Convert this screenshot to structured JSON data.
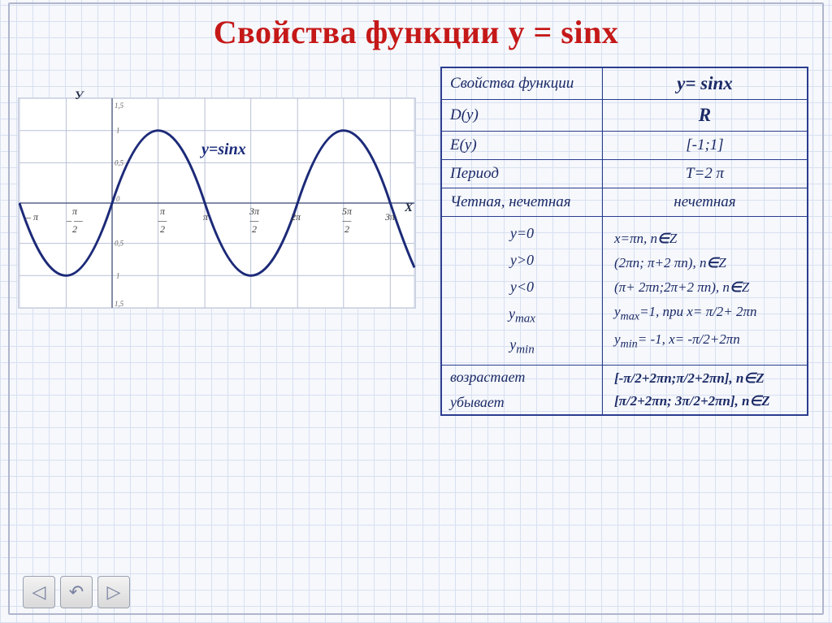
{
  "title": "Свойства функции y = sinx",
  "chart_label": "y=sinx",
  "axis_y": "У",
  "axis_x": "Х",
  "chart_data": {
    "type": "line",
    "title": "y = sin x",
    "xlabel": "x",
    "ylabel": "y",
    "xlim": [
      -3.5,
      10
    ],
    "ylim": [
      -1.5,
      1.5
    ],
    "x_ticks": [
      "-π",
      "-π/2",
      "0",
      "π/2",
      "π",
      "3π/2",
      "2π",
      "5π/2",
      "3π"
    ],
    "x_tick_values": [
      -3.1416,
      -1.5708,
      0,
      1.5708,
      3.1416,
      4.7124,
      6.2832,
      7.854,
      9.4248
    ],
    "y_ticks": [
      -1.5,
      -1,
      -0.5,
      0,
      0.5,
      1,
      1.5
    ],
    "series": [
      {
        "name": "sin x",
        "formula": "y = sin(x)",
        "domain": [
          -3.5,
          10
        ]
      }
    ]
  },
  "table": {
    "header_left": "Свойства функции",
    "header_right": "y= sinx",
    "rows": [
      {
        "k": "D(y)",
        "v": "R"
      },
      {
        "k": "E(y)",
        "v": "[-1;1]"
      },
      {
        "k": "Период",
        "v": "T=2 π"
      },
      {
        "k": "Четная, нечетная",
        "v": "нечетная"
      }
    ],
    "zeros_block": {
      "keys": [
        "y=0",
        "y>0",
        "y<0",
        "y_max",
        "y_min"
      ],
      "vals": [
        "x=πn, n∈Z",
        "(2πn; π+2 πn), n∈Z",
        "(π+ 2πn;2π+2 πn), n∈Z",
        "y_max=1, при x= π/2+ 2πn",
        "y_min= -1, x= -π/2+2πn"
      ]
    },
    "monotone": {
      "keys": [
        "возрастает",
        "убывает"
      ],
      "vals": [
        "[-π/2+2πn;π/2+2πn], n∈Z",
        "[π/2+2πn; 3π/2+2πn], n∈Z"
      ]
    }
  },
  "nav": {
    "back": "◁",
    "undo": "↶",
    "fwd": "▷"
  }
}
